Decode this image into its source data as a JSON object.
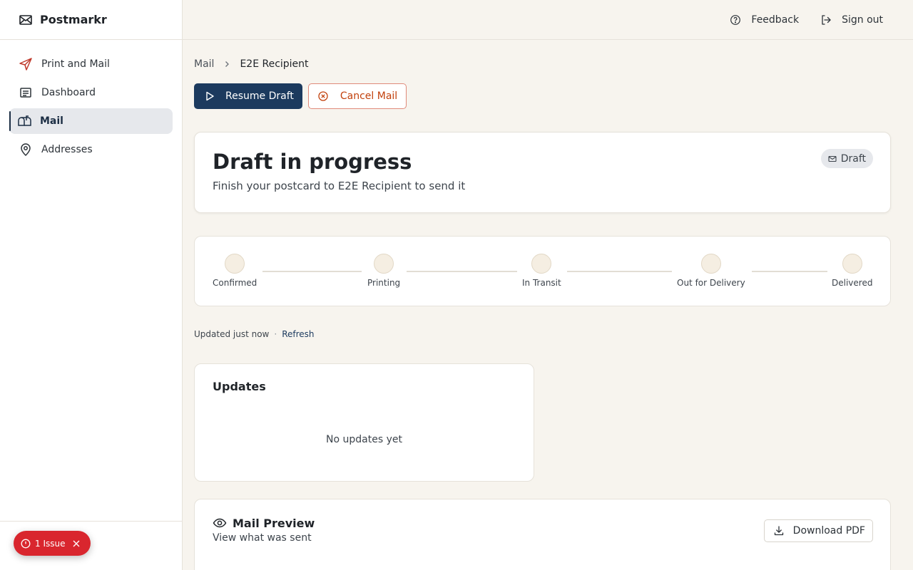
{
  "app": {
    "name": "Postmarkr",
    "logo_icon": "envelope-icon"
  },
  "sidebar": {
    "items": [
      {
        "label": "Print and Mail",
        "icon": "send-icon",
        "active": false
      },
      {
        "label": "Dashboard",
        "icon": "dashboard-icon",
        "active": false
      },
      {
        "label": "Mail",
        "icon": "mailbox-icon",
        "active": true
      },
      {
        "label": "Addresses",
        "icon": "map-pin-icon",
        "active": false
      }
    ],
    "issue_badge": "1 Issue"
  },
  "header": {
    "feedback_label": "Feedback",
    "signout_label": "Sign out"
  },
  "breadcrumb": {
    "parent": "Mail",
    "current": "E2E Recipient"
  },
  "actions": {
    "resume_label": "Resume Draft",
    "cancel_label": "Cancel Mail"
  },
  "status": {
    "title": "Draft in progress",
    "subtitle": "Finish your postcard to E2E Recipient to send it",
    "badge": "Draft"
  },
  "tracker": {
    "steps": [
      "Confirmed",
      "Printing",
      "In Transit",
      "Out for Delivery",
      "Delivered"
    ]
  },
  "updated": {
    "text": "Updated just now",
    "separator": "·",
    "refresh_label": "Refresh"
  },
  "updates": {
    "title": "Updates",
    "empty": "No updates yet"
  },
  "preview": {
    "title": "Mail Preview",
    "subtitle": "View what was sent",
    "download_label": "Download PDF"
  },
  "colors": {
    "primary": "#1c3a5e",
    "danger": "#c2410c",
    "issue": "#d9262e",
    "background": "#f7f4ee"
  }
}
